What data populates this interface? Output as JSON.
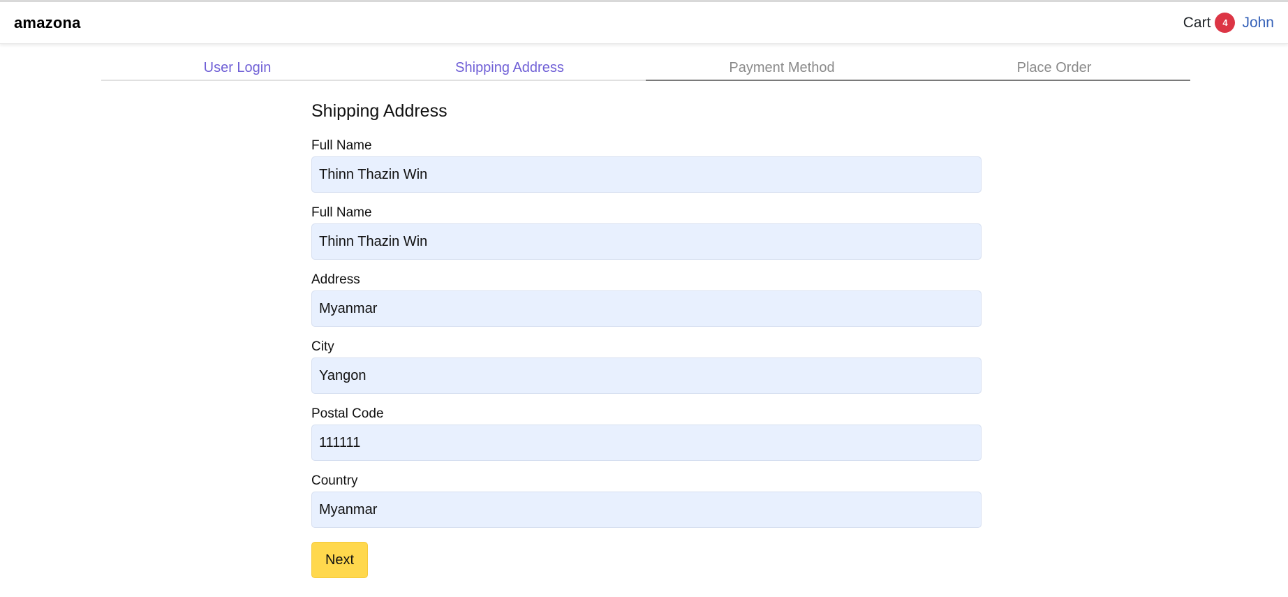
{
  "header": {
    "brand": "amazona",
    "cart_label": "Cart",
    "cart_count": "4",
    "user_name": "John"
  },
  "steps": [
    {
      "label": "User Login",
      "state": "active"
    },
    {
      "label": "Shipping Address",
      "state": "active"
    },
    {
      "label": "Payment Method",
      "state": "inactive"
    },
    {
      "label": "Place Order",
      "state": "inactive"
    }
  ],
  "form": {
    "title": "Shipping Address",
    "fields": [
      {
        "label": "Full Name",
        "value": "Thinn Thazin Win"
      },
      {
        "label": "Full Name",
        "value": "Thinn Thazin Win"
      },
      {
        "label": "Address",
        "value": "Myanmar"
      },
      {
        "label": "City",
        "value": "Yangon"
      },
      {
        "label": "Postal Code",
        "value": "111111"
      },
      {
        "label": "Country",
        "value": "Myanmar"
      }
    ],
    "next_label": "Next"
  },
  "colors": {
    "accent": "#6f5fd6",
    "badge": "#dc3545",
    "input_bg": "#e8f0fe",
    "button": "#ffd84d"
  }
}
